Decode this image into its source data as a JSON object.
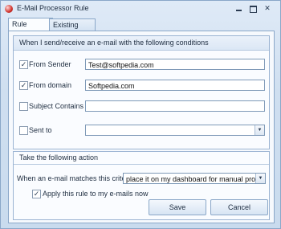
{
  "window": {
    "title": "E-Mail Processor Rule"
  },
  "tabs": [
    {
      "label": "Rule Details",
      "active": true
    },
    {
      "label": "Existing Rules",
      "active": false
    }
  ],
  "conditions": {
    "header": "When I send/receive an e-mail with the following conditions",
    "from_sender": {
      "label": "From Sender",
      "checked": true,
      "value": "Test@softpedia.com"
    },
    "from_domain": {
      "label": "From domain",
      "checked": true,
      "value": "Softpedia.com"
    },
    "subject": {
      "label": "Subject Contains",
      "checked": false,
      "value": ""
    },
    "sent_to": {
      "label": "Sent to",
      "checked": false,
      "value": ""
    }
  },
  "action": {
    "header": "Take the following action",
    "criteria_label": "When an e-mail matches this criteria",
    "criteria_value": "place it on my dashboard for manual processing",
    "apply_now": {
      "label": "Apply this rule to my e-mails now",
      "checked": true
    },
    "save_label": "Save",
    "cancel_label": "Cancel"
  },
  "icons": {
    "app": "app-icon",
    "minimize": "minimize-icon",
    "maximize": "maximize-icon",
    "close": "close-icon"
  }
}
